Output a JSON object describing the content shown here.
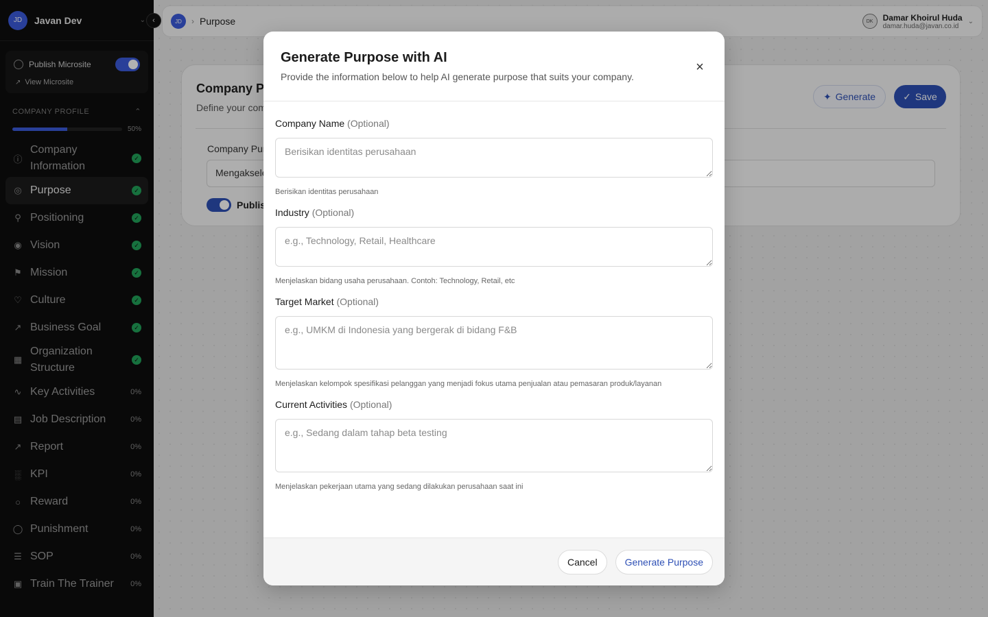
{
  "workspace": {
    "initials": "JD",
    "name": "Javan Dev"
  },
  "publish": {
    "label": "Publish Microsite",
    "view_label": "View Microsite"
  },
  "section": {
    "title": "COMPANY PROFILE",
    "progress_text": "50%",
    "progress_fraction": 0.5
  },
  "nav": [
    {
      "label": "Company Information",
      "status": "done"
    },
    {
      "label": "Purpose",
      "status": "done"
    },
    {
      "label": "Positioning",
      "status": "done"
    },
    {
      "label": "Vision",
      "status": "done"
    },
    {
      "label": "Mission",
      "status": "done"
    },
    {
      "label": "Culture",
      "status": "done"
    },
    {
      "label": "Business Goal",
      "status": "done"
    },
    {
      "label": "Organization Structure",
      "status": "done"
    },
    {
      "label": "Key Activities",
      "pct": "0%"
    },
    {
      "label": "Job Description",
      "pct": "0%"
    },
    {
      "label": "Report",
      "pct": "0%"
    },
    {
      "label": "KPI",
      "pct": "0%"
    },
    {
      "label": "Reward",
      "pct": "0%"
    },
    {
      "label": "Punishment",
      "pct": "0%"
    },
    {
      "label": "SOP",
      "pct": "0%"
    },
    {
      "label": "Train The Trainer",
      "pct": "0%"
    }
  ],
  "topbar": {
    "breadcrumb_initials": "JD",
    "breadcrumb": "Purpose",
    "user_initials": "DK",
    "user_name": "Damar Khoirul Huda",
    "user_email": "damar.huda@javan.co.id"
  },
  "card": {
    "title": "Company Pu",
    "subtitle": "Define your com",
    "generate_label": "Generate",
    "save_label": "Save",
    "field_label": "Company Pur",
    "field_value": "Mengaksele",
    "publish_label": "Publish"
  },
  "modal": {
    "title": "Generate Purpose with AI",
    "subtitle": "Provide the information below to help AI generate purpose that suits your company.",
    "optional": "(Optional)",
    "fields": [
      {
        "label": "Company Name",
        "placeholder": "Berisikan identitas perusahaan",
        "hint": "Berisikan identitas perusahaan"
      },
      {
        "label": "Industry",
        "placeholder": "e.g., Technology, Retail, Healthcare",
        "hint": "Menjelaskan bidang usaha perusahaan. Contoh: Technology, Retail, etc"
      },
      {
        "label": "Target Market",
        "placeholder": "e.g., UMKM di Indonesia yang bergerak di bidang F&B",
        "hint": "Menjelaskan kelompok spesifikasi pelanggan yang menjadi fokus utama penjualan atau pemasaran produk/layanan"
      },
      {
        "label": "Current Activities",
        "placeholder": "e.g., Sedang dalam tahap beta testing",
        "hint": "Menjelaskan pekerjaan utama yang sedang dilakukan perusahaan saat ini"
      }
    ],
    "cancel_label": "Cancel",
    "submit_label": "Generate Purpose"
  },
  "colors": {
    "accent": "#2d4fb5",
    "success": "#22a35a",
    "sidebar_bg": "#0d0d0d"
  }
}
